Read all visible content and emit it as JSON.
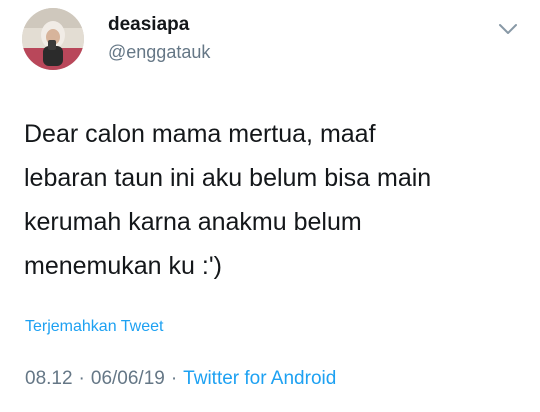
{
  "user": {
    "display_name": "deasiapa",
    "handle": "@enggatauk"
  },
  "tweet": {
    "text": "Dear calon mama mertua, maaf\nlebaran taun ini aku belum bisa main\nkerumah karna anakmu belum\nmenemukan ku :')",
    "translate_label": "Terjemahkan Tweet"
  },
  "meta": {
    "time": "08.12",
    "separator": "·",
    "date": "06/06/19",
    "source": "Twitter for Android"
  },
  "icons": {
    "menu": "chevron-down-icon"
  },
  "colors": {
    "text": "#14171a",
    "secondary": "#657786",
    "link": "#1da1f2"
  }
}
